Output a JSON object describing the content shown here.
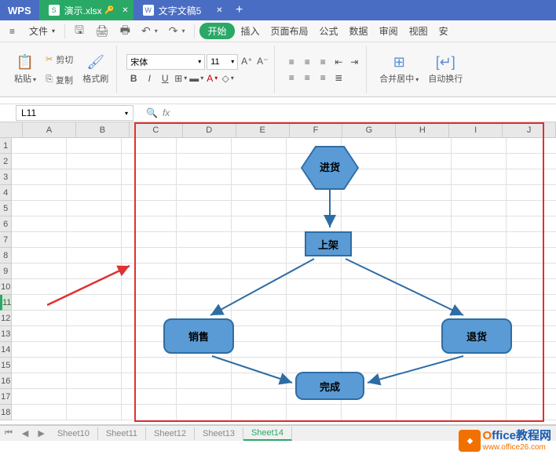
{
  "titlebar": {
    "logo": "WPS",
    "tabs": [
      {
        "icon": "S",
        "label": "演示.xlsx",
        "active": true,
        "key": true
      },
      {
        "icon": "W",
        "label": "文字文稿5",
        "active": false
      }
    ],
    "newtab": "+"
  },
  "menubar": {
    "file": "文件",
    "start": "开始",
    "items": [
      "插入",
      "页面布局",
      "公式",
      "数据",
      "审阅",
      "视图",
      "安"
    ]
  },
  "ribbon": {
    "paste": "粘贴",
    "cut": "剪切",
    "copy": "复制",
    "format_painter": "格式刷",
    "font_name": "宋体",
    "font_size": "11",
    "merge_center": "合并居中",
    "auto_wrap": "自动换行"
  },
  "formula": {
    "cell_ref": "L11",
    "fx": "fx"
  },
  "grid": {
    "columns": [
      "A",
      "B",
      "C",
      "D",
      "E",
      "F",
      "G",
      "H",
      "I",
      "J"
    ],
    "rows": [
      "1",
      "2",
      "3",
      "4",
      "5",
      "6",
      "7",
      "8",
      "9",
      "10",
      "11",
      "12",
      "13",
      "14",
      "15",
      "16",
      "17",
      "18"
    ],
    "selected_row": "11"
  },
  "flowchart": {
    "n1": "进货",
    "n2": "上架",
    "n3": "销售",
    "n4": "退货",
    "n5": "完成"
  },
  "sheets": {
    "tabs": [
      "Sheet10",
      "Sheet11",
      "Sheet12",
      "Sheet13",
      "Sheet14"
    ],
    "active": "Sheet14"
  },
  "watermark": {
    "line1a": "O",
    "line1b": "ffice教程网",
    "line2": "www.office26.com"
  },
  "chart_data": {
    "type": "flowchart",
    "nodes": [
      {
        "id": "n1",
        "label": "进货",
        "shape": "hexagon"
      },
      {
        "id": "n2",
        "label": "上架",
        "shape": "rectangle"
      },
      {
        "id": "n3",
        "label": "销售",
        "shape": "rounded-rectangle"
      },
      {
        "id": "n4",
        "label": "退货",
        "shape": "rounded-rectangle"
      },
      {
        "id": "n5",
        "label": "完成",
        "shape": "rounded-rectangle"
      }
    ],
    "edges": [
      {
        "from": "n1",
        "to": "n2",
        "style": "arrow"
      },
      {
        "from": "n2",
        "to": "n3",
        "style": "arrow"
      },
      {
        "from": "n2",
        "to": "n4",
        "style": "arrow"
      },
      {
        "from": "n3",
        "to": "n5",
        "style": "arrow"
      },
      {
        "from": "n4",
        "to": "n5",
        "style": "arrow"
      }
    ]
  }
}
